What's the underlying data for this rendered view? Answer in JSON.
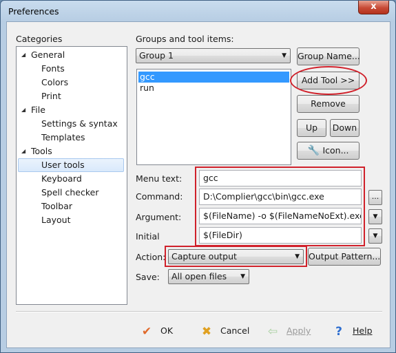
{
  "window": {
    "title": "Preferences",
    "close_glyph": "x"
  },
  "categories": {
    "heading": "Categories",
    "items": [
      {
        "label": "General",
        "level": 0,
        "expanded": true
      },
      {
        "label": "Fonts",
        "level": 1
      },
      {
        "label": "Colors",
        "level": 1
      },
      {
        "label": "Print",
        "level": 1
      },
      {
        "label": "File",
        "level": 0,
        "expanded": true
      },
      {
        "label": "Settings & syntax",
        "level": 1
      },
      {
        "label": "Templates",
        "level": 1
      },
      {
        "label": "Tools",
        "level": 0,
        "expanded": true
      },
      {
        "label": "User tools",
        "level": 1,
        "selected": true
      },
      {
        "label": "Keyboard",
        "level": 1
      },
      {
        "label": "Spell checker",
        "level": 1
      },
      {
        "label": "Toolbar",
        "level": 1
      },
      {
        "label": "Layout",
        "level": 1
      }
    ]
  },
  "groups": {
    "heading": "Groups and tool items:",
    "selected_group": "Group 1",
    "tools": [
      {
        "label": "gcc",
        "selected": true
      },
      {
        "label": "run",
        "selected": false
      }
    ]
  },
  "buttons": {
    "group_name": "Group Name...",
    "add_tool": "Add Tool >>",
    "remove": "Remove",
    "up": "Up",
    "down": "Down",
    "icon": "Icon...",
    "browse": "...",
    "output_pattern": "Output Pattern..."
  },
  "form": {
    "menu_text": {
      "label": "Menu text:",
      "value": "gcc"
    },
    "command": {
      "label": "Command:",
      "value": "D:\\Complier\\gcc\\bin\\gcc.exe"
    },
    "argument": {
      "label": "Argument:",
      "value": "$(FileName) -o $(FileNameNoExt).exe"
    },
    "initial": {
      "label": "Initial",
      "value": "$(FileDir)"
    },
    "action": {
      "label": "Action:",
      "value": "Capture output"
    },
    "save": {
      "label": "Save:",
      "value": "All open files"
    }
  },
  "footer": {
    "ok": "OK",
    "cancel": "Cancel",
    "apply": "Apply",
    "help": "Help"
  },
  "colors": {
    "highlight_annotation": "#d0202a",
    "selection": "#3399ff",
    "ok_check": "#e06a2b",
    "cancel_x": "#e0a020",
    "help_icon": "#2f6fd0"
  }
}
